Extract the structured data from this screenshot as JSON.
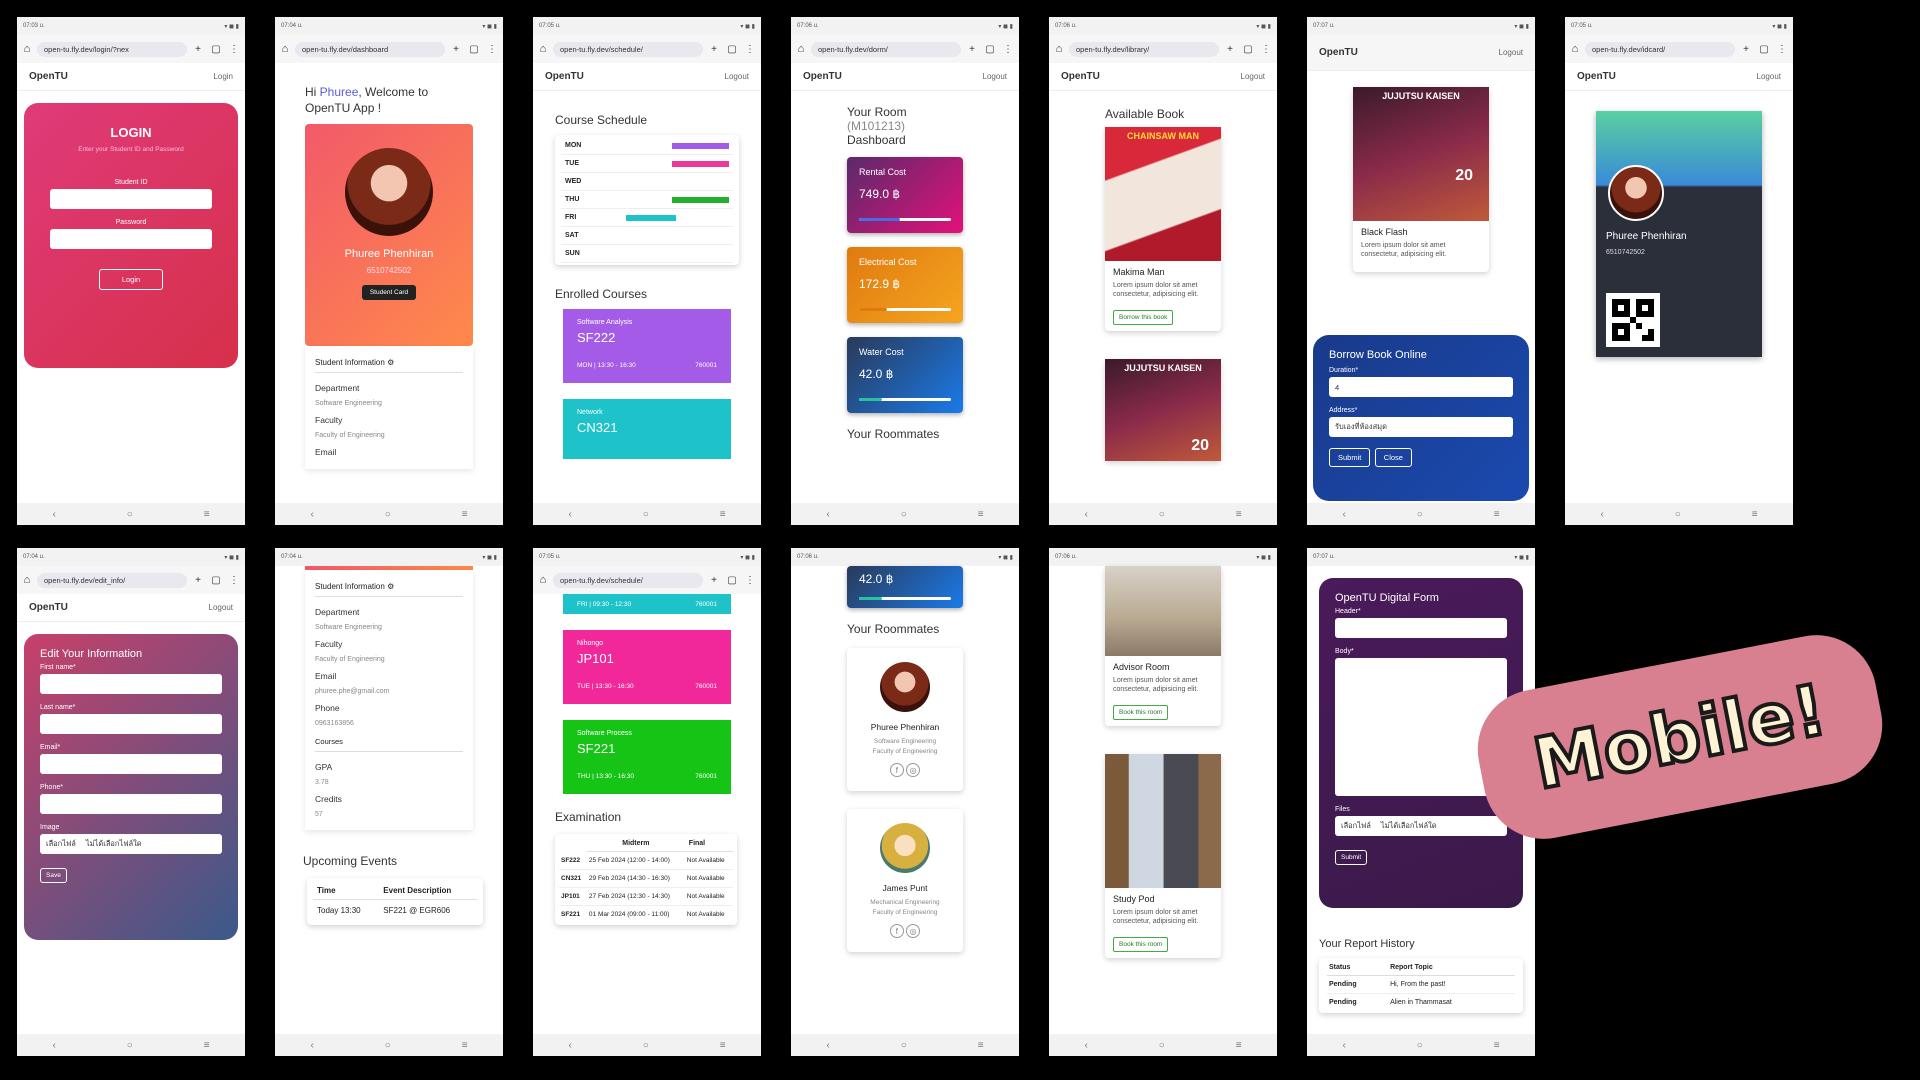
{
  "common": {
    "nav_back": "‹",
    "nav_home": "○",
    "nav_menu": "≡",
    "brand": "OpenTU",
    "login": "Login",
    "logout": "Logout"
  },
  "phones": {
    "p1": {
      "time": "07:03 u.",
      "url": "open-tu.fly.dev/login/?nex",
      "title": "LOGIN",
      "subtitle": "Enter your Student ID and Password",
      "student_id_label": "Student ID",
      "password_label": "Password",
      "button": "Login"
    },
    "p2": {
      "time": "07:04 u.",
      "url": "open-tu.fly.dev/dashboard",
      "greet_pre": "Hi ",
      "name_hl": "Phuree",
      "greet_post": ", Welcome to OpenTU App !",
      "name": "Phuree Phenhiran",
      "id": "6510742502",
      "card_btn": "Student Card",
      "info_header": "Student Information",
      "department_label": "Department",
      "department": "Software Engineering",
      "faculty_label": "Faculty",
      "faculty": "Faculty of Engineering",
      "email_label": "Email"
    },
    "p3": {
      "time": "07:05 u.",
      "url": "open-tu.fly.dev/schedule/",
      "title": "Course Schedule",
      "days": [
        "MON",
        "TUE",
        "WED",
        "THU",
        "FRI",
        "SAT",
        "SUN"
      ],
      "enrolled": "Enrolled Courses",
      "c1_sub": "Software Analysis",
      "c1_code": "SF222",
      "c1_time": "MON | 13:30 - 16:30",
      "c1_sec": "760001",
      "c2_sub": "Network",
      "c2_code": "CN321"
    },
    "p4": {
      "time": "07:06 u.",
      "url": "open-tu.fly.dev/dorm/",
      "room_title": "Your Room",
      "room_code": "(M101213)",
      "dash": "Dashboard",
      "rent_label": "Rental Cost",
      "rent": "749.0 ฿",
      "elec_label": "Electrical Cost",
      "elec": "172.9 ฿",
      "water_label": "Water Cost",
      "water": "42.0 ฿",
      "roommates": "Your Roommates"
    },
    "p5": {
      "time": "07:06 u.",
      "url": "open-tu.fly.dev/library/",
      "title": "Available Book",
      "book1": "Makima Man",
      "desc": "Lorem ipsum dolor sit amet consectetur, adipisicing elit.",
      "borrow": "Borrow this book",
      "cover1_text": "CHAINSAW MAN",
      "cover2_text": "JUJUTSU KAISEN",
      "cover2_num": "20"
    },
    "p6": {
      "time": "07:07 u.",
      "book": "Black Flash",
      "desc": "Lorem ipsum dolor sit amet consectetur, adipisicing elit.",
      "form_title": "Borrow Book Online",
      "duration_label": "Duration*",
      "duration": "4",
      "address_label": "Address*",
      "address": "รับเองที่ห้องสมุด",
      "submit": "Submit",
      "close": "Close",
      "cover_text": "JUJUTSU KAISEN",
      "cover_num": "20"
    },
    "p7": {
      "time": "07:05 u.",
      "url": "open-tu.fly.dev/idcard/",
      "name": "Phuree Phenhiran",
      "id": "6510742502"
    },
    "p8": {
      "time": "07:04 u.",
      "url": "open-tu.fly.dev/edit_info/",
      "title": "Edit Your Information",
      "first": "First name*",
      "last": "Last name*",
      "email": "Email*",
      "phone": "Phone*",
      "image": "Image",
      "choose": "เลือกไฟล์",
      "nofile": "ไม่ได้เลือกไฟล์ใด",
      "save": "Save"
    },
    "p9": {
      "time": "07:04 u.",
      "info_header": "Student Information",
      "department_label": "Department",
      "department": "Software Engineering",
      "faculty_label": "Faculty",
      "faculty": "Faculty of Engineering",
      "email_label": "Email",
      "email": "phuree.phe@gmail.com",
      "phone_label": "Phone",
      "phone": "0963163856",
      "courses": "Courses",
      "gpa_label": "GPA",
      "gpa": "3.78",
      "credits_label": "Credits",
      "credits": "57",
      "events": "Upcoming Events",
      "th_time": "Time",
      "th_desc": "Event Description",
      "ev_time": "Today 13:30",
      "ev_desc": "SF221 @ EGR606"
    },
    "p10": {
      "time": "07:05 u.",
      "url": "open-tu.fly.dev/schedule/",
      "prev_time": "FRI | 09:30 - 12:30",
      "prev_sec": "760001",
      "c3_sub": "Nihongo",
      "c3_code": "JP101",
      "c3_time": "TUE | 13:30 - 16:30",
      "c3_sec": "760001",
      "c4_sub": "Software Process",
      "c4_code": "SF221",
      "c4_time": "THU | 13:30 - 16:30",
      "c4_sec": "760001",
      "exam": "Examination",
      "th_mid": "Midterm",
      "th_final": "Final",
      "exams": [
        [
          "SF222",
          "25 Feb 2024 (12:00 - 14:00)",
          "Not Available"
        ],
        [
          "CN321",
          "29 Feb 2024 (14:30 - 16:30)",
          "Not Available"
        ],
        [
          "JP101",
          "27 Feb 2024 (12:30 - 14:30)",
          "Not Available"
        ],
        [
          "SF221",
          "01 Mar 2024 (09:00 - 11:00)",
          "Not Available"
        ]
      ]
    },
    "p11": {
      "time": "07:06 u.",
      "water": "42.0 ฿",
      "roommates": "Your Roommates",
      "r1_name": "Phuree Phenhiran",
      "r1_dept": "Software Engineering",
      "r1_fac": "Faculty of Engineering",
      "r2_name": "James Punt",
      "r2_dept": "Mechanical Engineering",
      "r2_fac": "Faculty of Engineering"
    },
    "p12": {
      "time": "07:06 u.",
      "room1": "Advisor Room",
      "room2": "Study Pod",
      "desc": "Lorem ipsum dolor sit amet consectetur, adipisicing elit.",
      "book": "Book this room"
    },
    "p13": {
      "time": "07:07 u.",
      "form_title": "OpenTU Digital Form",
      "header_label": "Header*",
      "body_label": "Body*",
      "files_label": "Files",
      "choose": "เลือกไฟล์",
      "nofile": "ไม่ได้เลือกไฟล์ใด",
      "submit": "Submit",
      "history": "Your Report History",
      "th_status": "Status",
      "th_topic": "Report Topic",
      "rows": [
        [
          "Pending",
          "Hi, From the past!"
        ],
        [
          "Pending",
          "Alien in Thammasat"
        ]
      ]
    }
  },
  "tag": "Mobile!"
}
